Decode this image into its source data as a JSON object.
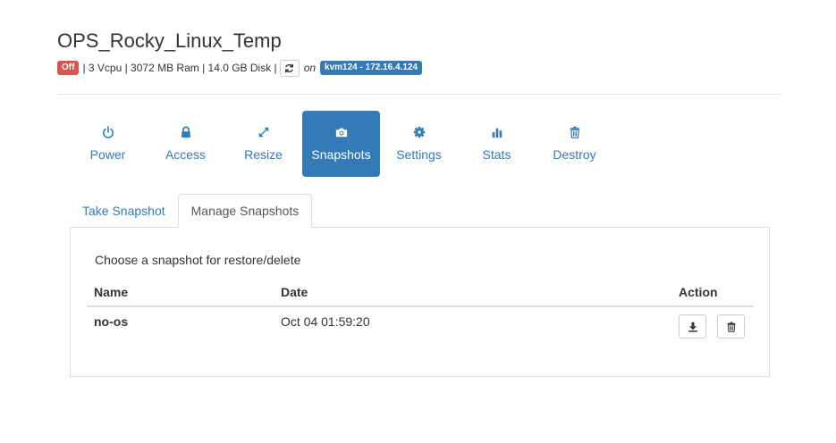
{
  "header": {
    "title": "OPS_Rocky_Linux_Temp",
    "status": "Off",
    "specs": "| 3 Vcpu | 3072 MB Ram | 14.0 GB Disk |",
    "on_text": "on",
    "host": "kvm124 - 172.16.4.124",
    "refresh_icon": "refresh-icon"
  },
  "actions": [
    {
      "label": "Power",
      "icon": "power-icon"
    },
    {
      "label": "Access",
      "icon": "lock-icon"
    },
    {
      "label": "Resize",
      "icon": "resize-icon"
    },
    {
      "label": "Snapshots",
      "icon": "camera-icon",
      "active": true
    },
    {
      "label": "Settings",
      "icon": "gear-icon"
    },
    {
      "label": "Stats",
      "icon": "bar-chart-icon"
    },
    {
      "label": "Destroy",
      "icon": "trash-icon"
    }
  ],
  "tabs": [
    {
      "label": "Take Snapshot"
    },
    {
      "label": "Manage Snapshots",
      "active": true
    }
  ],
  "panel": {
    "intro": "Choose a snapshot for restore/delete",
    "columns": [
      "Name",
      "Date",
      "Action"
    ],
    "rows": [
      {
        "name": "no-os",
        "date": "Oct 04 01:59:20",
        "actions": [
          "download-icon",
          "trash-icon"
        ]
      }
    ]
  },
  "colors": {
    "primary": "#337ab7",
    "danger": "#d9534f",
    "border": "#dddddd"
  }
}
